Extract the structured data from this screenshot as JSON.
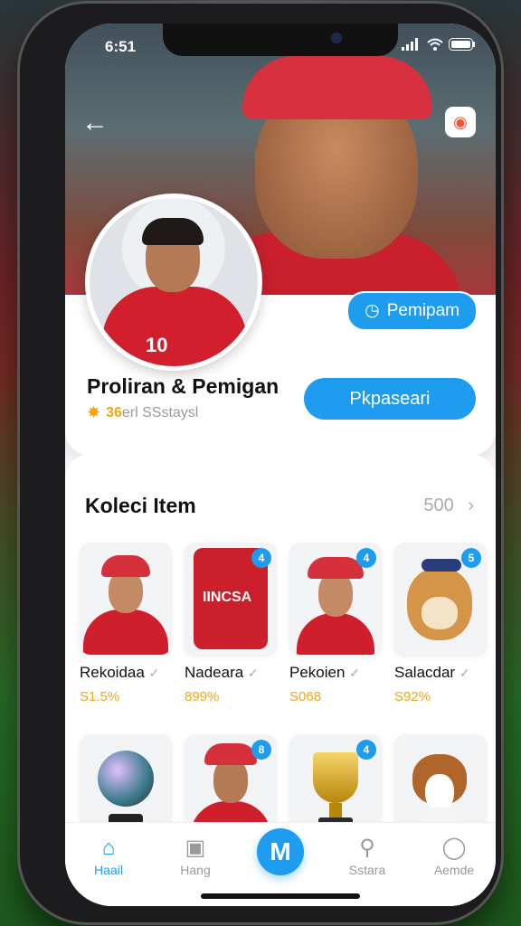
{
  "status": {
    "time": "6:51"
  },
  "profile": {
    "name": "Proliran & Pemigan",
    "sub_count": "36",
    "sub_text": "erl SSstaysl",
    "small_pill": "Pemipam",
    "big_pill": "Pkpaseari"
  },
  "collection": {
    "title": "Koleci Item",
    "count": "500",
    "items": [
      {
        "name": "Rekoidaa",
        "price": "S1.5%",
        "badge": ""
      },
      {
        "name": "Nadeara",
        "price": "899%",
        "badge": "4",
        "shirt_text": "IINCSA"
      },
      {
        "name": "Pekoien",
        "price": "S068",
        "badge": "4"
      },
      {
        "name": "Salacdar",
        "price": "S92%",
        "badge": "5"
      },
      {
        "name": "",
        "price": "",
        "badge": ""
      },
      {
        "name": "",
        "price": "",
        "badge": "8"
      },
      {
        "name": "",
        "price": "",
        "badge": "4"
      },
      {
        "name": "",
        "price": "",
        "badge": ""
      }
    ]
  },
  "nav": {
    "home": "Haail",
    "hang": "Hang",
    "center": "M",
    "search": "Sstara",
    "profile": "Aemde"
  },
  "colors": {
    "accent": "#1e9cf0",
    "gold": "#f2a614"
  }
}
